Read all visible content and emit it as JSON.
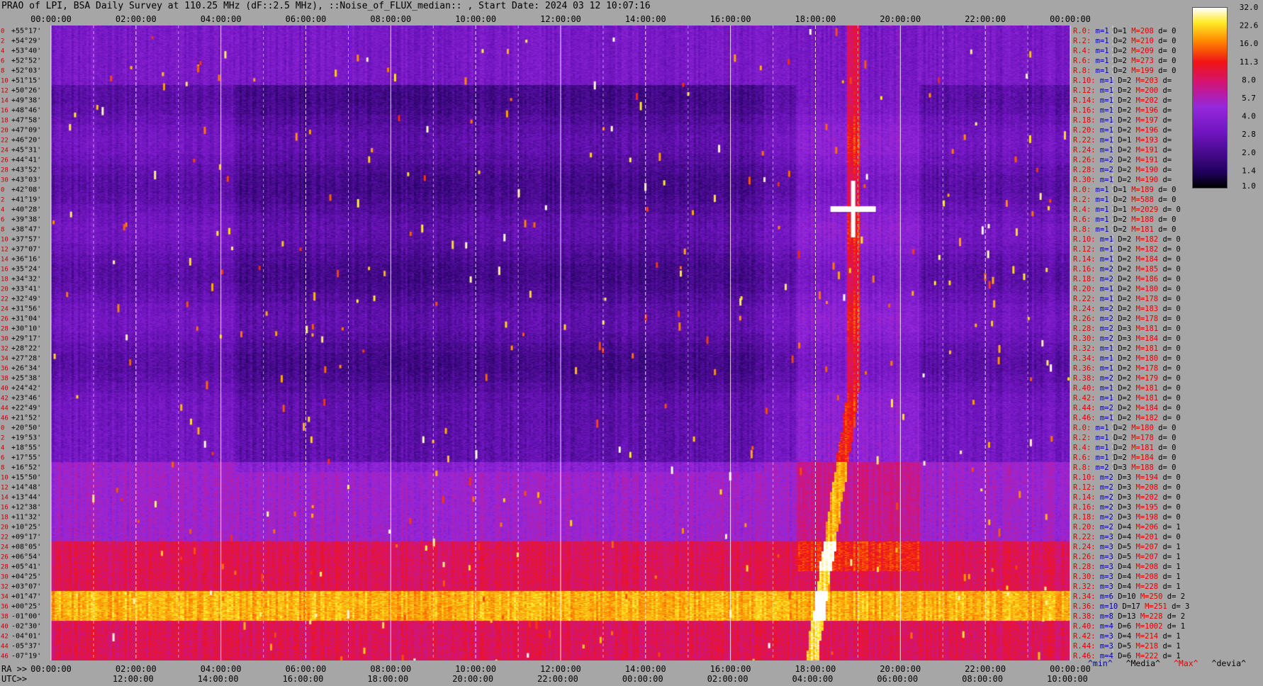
{
  "title": "PRAO of LPI, BSA Daily Survey at 110.25 MHz (dF::2.5 MHz), ::Noise_of_FLUX_median:: , Start Date: 2024 03 12 10:07:16",
  "colors": {
    "background": "#a6a6a6",
    "stat_red": "#e00000",
    "stat_blue": "#0000b0"
  },
  "chart_data": {
    "type": "heatmap",
    "colormap": "black-purple-red-yellow-white (gnuplot-like)",
    "colorbar": {
      "min": 1.0,
      "max": 32.0,
      "scale": "log",
      "ticks": [
        "32.0",
        "22.6",
        "16.0",
        "11.3",
        "8.0",
        "5.7",
        "4.0",
        "2.8",
        "2.0",
        "1.4",
        "1.0"
      ]
    },
    "x_top_ticks": [
      "00:00:00",
      "02:00:00",
      "04:00:00",
      "06:00:00",
      "08:00:00",
      "10:00:00",
      "12:00:00",
      "14:00:00",
      "16:00:00",
      "18:00:00",
      "20:00:00",
      "22:00:00",
      "00:00:00"
    ],
    "x_bottom_ra_label": "RA >>",
    "x_bottom_ra_ticks": [
      "00:00:00",
      "02:00:00",
      "04:00:00",
      "06:00:00",
      "08:00:00",
      "10:00:00",
      "12:00:00",
      "14:00:00",
      "16:00:00",
      "18:00:00",
      "20:00:00",
      "22:00:00",
      "00:00:00"
    ],
    "x_bottom_utc_label": "UTC>>",
    "x_bottom_utc_ticks": [
      "12:00:00",
      "14:00:00",
      "16:00:00",
      "18:00:00",
      "20:00:00",
      "22:00:00",
      "00:00:00",
      "02:00:00",
      "04:00:00",
      "06:00:00",
      "08:00:00",
      "10:00:00"
    ],
    "y_labels": [
      "+55°17'",
      "+54°29'",
      "+53°40'",
      "+52°52'",
      "+52°03'",
      "+51°15'",
      "+50°26'",
      "+49°38'",
      "+48°46'",
      "+47°58'",
      "+47°09'",
      "+46°20'",
      "+45°31'",
      "+44°41'",
      "+43°52'",
      "+43°03'",
      "+42°08'",
      "+41°19'",
      "+40°28'",
      "+39°38'",
      "+38°47'",
      "+37°57'",
      "+37°07'",
      "+36°16'",
      "+35°24'",
      "+34°32'",
      "+33°41'",
      "+32°49'",
      "+31°56'",
      "+31°04'",
      "+30°10'",
      "+29°17'",
      "+28°22'",
      "+27°28'",
      "+26°34'",
      "+25°38'",
      "+24°42'",
      "+23°46'",
      "+22°49'",
      "+21°52'",
      "+20°50'",
      "+19°53'",
      "+18°55'",
      "+17°55'",
      "+16°52'",
      "+15°50'",
      "+14°48'",
      "+13°44'",
      "+12°38'",
      "+11°32'",
      "+10°25'",
      "+09°17'",
      "+08°05'",
      "+06°54'",
      "+05°41'",
      "+04°25'",
      "+03°07'",
      "+01°47'",
      "+00°25'",
      "-01°00'",
      "-02°30'",
      "-04°01'",
      "-05°37'",
      "-07°19'"
    ],
    "row_index_labels": [
      "0",
      "2",
      "4",
      "6",
      "8",
      "10",
      "12",
      "14",
      "16",
      "18",
      "20",
      "22",
      "24",
      "26",
      "28",
      "30",
      "0",
      "2",
      "4",
      "6",
      "8",
      "10",
      "12",
      "14",
      "16",
      "18",
      "20",
      "22",
      "24",
      "26",
      "28",
      "30",
      "32",
      "34",
      "36",
      "38",
      "40",
      "42",
      "44",
      "46",
      "0",
      "2",
      "4",
      "6",
      "8",
      "10",
      "12",
      "14",
      "16",
      "18",
      "20",
      "22",
      "24",
      "26",
      "28",
      "30",
      "32",
      "34",
      "36",
      "38",
      "40",
      "42",
      "44",
      "46"
    ],
    "row_stats": [
      {
        "ray": "R.0:",
        "m": "m=1",
        "D": "D=1",
        "M": "M=208",
        "d": "d= 0"
      },
      {
        "ray": "R.2:",
        "m": "m=1",
        "D": "D=2",
        "M": "M=210",
        "d": "d= 0"
      },
      {
        "ray": "R.4:",
        "m": "m=1",
        "D": "D=2",
        "M": "M=209",
        "d": "d= 0"
      },
      {
        "ray": "R.6:",
        "m": "m=1",
        "D": "D=2",
        "M": "M=273",
        "d": "d= 0"
      },
      {
        "ray": "R.8:",
        "m": "m=1",
        "D": "D=2",
        "M": "M=199",
        "d": "d= 0"
      },
      {
        "ray": "R.10:",
        "m": "m=1",
        "D": "D=2",
        "M": "M=203",
        "d": "d="
      },
      {
        "ray": "R.12:",
        "m": "m=1",
        "D": "D=2",
        "M": "M=200",
        "d": "d="
      },
      {
        "ray": "R.14:",
        "m": "m=1",
        "D": "D=2",
        "M": "M=202",
        "d": "d="
      },
      {
        "ray": "R.16:",
        "m": "m=1",
        "D": "D=2",
        "M": "M=196",
        "d": "d="
      },
      {
        "ray": "R.18:",
        "m": "m=1",
        "D": "D=2",
        "M": "M=197",
        "d": "d="
      },
      {
        "ray": "R.20:",
        "m": "m=1",
        "D": "D=2",
        "M": "M=196",
        "d": "d="
      },
      {
        "ray": "R.22:",
        "m": "m=1",
        "D": "D=1",
        "M": "M=193",
        "d": "d="
      },
      {
        "ray": "R.24:",
        "m": "m=1",
        "D": "D=2",
        "M": "M=191",
        "d": "d="
      },
      {
        "ray": "R.26:",
        "m": "m=2",
        "D": "D=2",
        "M": "M=191",
        "d": "d="
      },
      {
        "ray": "R.28:",
        "m": "m=2",
        "D": "D=2",
        "M": "M=190",
        "d": "d="
      },
      {
        "ray": "R.30:",
        "m": "m=1",
        "D": "D=2",
        "M": "M=190",
        "d": "d="
      },
      {
        "ray": "R.0:",
        "m": "m=1",
        "D": "D=1",
        "M": "M=189",
        "d": "d= 0"
      },
      {
        "ray": "R.2:",
        "m": "m=1",
        "D": "D=2",
        "M": "M=588",
        "d": "d= 0"
      },
      {
        "ray": "R.4:",
        "m": "m=1",
        "D": "D=1",
        "M": "M=2029",
        "d": "d= 0"
      },
      {
        "ray": "R.6:",
        "m": "m=1",
        "D": "D=2",
        "M": "M=188",
        "d": "d= 0"
      },
      {
        "ray": "R.8:",
        "m": "m=1",
        "D": "D=2",
        "M": "M=181",
        "d": "d= 0"
      },
      {
        "ray": "R.10:",
        "m": "m=1",
        "D": "D=2",
        "M": "M=182",
        "d": "d= 0"
      },
      {
        "ray": "R.12:",
        "m": "m=1",
        "D": "D=2",
        "M": "M=182",
        "d": "d= 0"
      },
      {
        "ray": "R.14:",
        "m": "m=1",
        "D": "D=2",
        "M": "M=184",
        "d": "d= 0"
      },
      {
        "ray": "R.16:",
        "m": "m=2",
        "D": "D=2",
        "M": "M=185",
        "d": "d= 0"
      },
      {
        "ray": "R.18:",
        "m": "m=2",
        "D": "D=2",
        "M": "M=186",
        "d": "d= 0"
      },
      {
        "ray": "R.20:",
        "m": "m=1",
        "D": "D=2",
        "M": "M=180",
        "d": "d= 0"
      },
      {
        "ray": "R.22:",
        "m": "m=1",
        "D": "D=2",
        "M": "M=178",
        "d": "d= 0"
      },
      {
        "ray": "R.24:",
        "m": "m=2",
        "D": "D=2",
        "M": "M=183",
        "d": "d= 0"
      },
      {
        "ray": "R.26:",
        "m": "m=2",
        "D": "D=2",
        "M": "M=178",
        "d": "d= 0"
      },
      {
        "ray": "R.28:",
        "m": "m=2",
        "D": "D=3",
        "M": "M=181",
        "d": "d= 0"
      },
      {
        "ray": "R.30:",
        "m": "m=2",
        "D": "D=3",
        "M": "M=184",
        "d": "d= 0"
      },
      {
        "ray": "R.32:",
        "m": "m=1",
        "D": "D=2",
        "M": "M=181",
        "d": "d= 0"
      },
      {
        "ray": "R.34:",
        "m": "m=1",
        "D": "D=2",
        "M": "M=180",
        "d": "d= 0"
      },
      {
        "ray": "R.36:",
        "m": "m=1",
        "D": "D=2",
        "M": "M=178",
        "d": "d= 0"
      },
      {
        "ray": "R.38:",
        "m": "m=2",
        "D": "D=2",
        "M": "M=179",
        "d": "d= 0"
      },
      {
        "ray": "R.40:",
        "m": "m=1",
        "D": "D=2",
        "M": "M=181",
        "d": "d= 0"
      },
      {
        "ray": "R.42:",
        "m": "m=1",
        "D": "D=2",
        "M": "M=181",
        "d": "d= 0"
      },
      {
        "ray": "R.44:",
        "m": "m=2",
        "D": "D=2",
        "M": "M=184",
        "d": "d= 0"
      },
      {
        "ray": "R.46:",
        "m": "m=1",
        "D": "D=2",
        "M": "M=182",
        "d": "d= 0"
      },
      {
        "ray": "R.0:",
        "m": "m=1",
        "D": "D=2",
        "M": "M=180",
        "d": "d= 0"
      },
      {
        "ray": "R.2:",
        "m": "m=1",
        "D": "D=2",
        "M": "M=178",
        "d": "d= 0"
      },
      {
        "ray": "R.4:",
        "m": "m=1",
        "D": "D=2",
        "M": "M=181",
        "d": "d= 0"
      },
      {
        "ray": "R.6:",
        "m": "m=1",
        "D": "D=2",
        "M": "M=184",
        "d": "d= 0"
      },
      {
        "ray": "R.8:",
        "m": "m=2",
        "D": "D=3",
        "M": "M=188",
        "d": "d= 0"
      },
      {
        "ray": "R.10:",
        "m": "m=2",
        "D": "D=3",
        "M": "M=194",
        "d": "d= 0"
      },
      {
        "ray": "R.12:",
        "m": "m=2",
        "D": "D=3",
        "M": "M=208",
        "d": "d= 0"
      },
      {
        "ray": "R.14:",
        "m": "m=2",
        "D": "D=3",
        "M": "M=202",
        "d": "d= 0"
      },
      {
        "ray": "R.16:",
        "m": "m=2",
        "D": "D=3",
        "M": "M=195",
        "d": "d= 0"
      },
      {
        "ray": "R.18:",
        "m": "m=2",
        "D": "D=3",
        "M": "M=198",
        "d": "d= 0"
      },
      {
        "ray": "R.20:",
        "m": "m=2",
        "D": "D=4",
        "M": "M=206",
        "d": "d= 1"
      },
      {
        "ray": "R.22:",
        "m": "m=3",
        "D": "D=4",
        "M": "M=201",
        "d": "d= 0"
      },
      {
        "ray": "R.24:",
        "m": "m=3",
        "D": "D=5",
        "M": "M=207",
        "d": "d= 1"
      },
      {
        "ray": "R.26:",
        "m": "m=3",
        "D": "D=5",
        "M": "M=207",
        "d": "d= 1"
      },
      {
        "ray": "R.28:",
        "m": "m=3",
        "D": "D=4",
        "M": "M=208",
        "d": "d= 1"
      },
      {
        "ray": "R.30:",
        "m": "m=3",
        "D": "D=4",
        "M": "M=208",
        "d": "d= 1"
      },
      {
        "ray": "R.32:",
        "m": "m=3",
        "D": "D=4",
        "M": "M=228",
        "d": "d= 1"
      },
      {
        "ray": "R.34:",
        "m": "m=6",
        "D": "D=10",
        "M": "M=250",
        "d": "d= 2"
      },
      {
        "ray": "R.36:",
        "m": "m=10",
        "D": "D=17",
        "M": "M=251",
        "d": "d= 3"
      },
      {
        "ray": "R.38:",
        "m": "m=8",
        "D": "D=13",
        "M": "M=228",
        "d": "d= 2"
      },
      {
        "ray": "R.40:",
        "m": "m=4",
        "D": "D=6",
        "M": "M=1002",
        "d": "d= 1"
      },
      {
        "ray": "R.42:",
        "m": "m=3",
        "D": "D=4",
        "M": "M=214",
        "d": "d= 1"
      },
      {
        "ray": "R.44:",
        "m": "m=3",
        "D": "D=5",
        "M": "M=218",
        "d": "d= 1"
      },
      {
        "ray": "R.46:",
        "m": "m=4",
        "D": "D=6",
        "M": "M=222",
        "d": "d= 1"
      }
    ],
    "legend": [
      "^min^",
      "^Media^",
      "^Max^",
      "^devia^"
    ],
    "grid": "dashed and solid vertical lines at each 2-hour RA mark"
  }
}
